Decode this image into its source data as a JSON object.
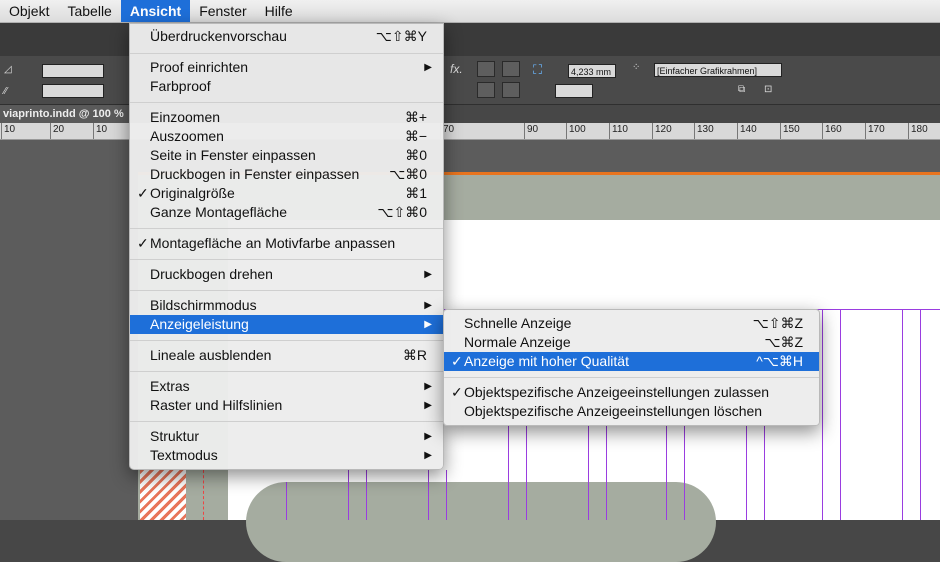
{
  "menubar": {
    "items": [
      "Objekt",
      "Tabelle",
      "Ansicht",
      "Fenster",
      "Hilfe"
    ]
  },
  "document_tab": "viaprinto.indd @ 100 %",
  "ruler_ticks": [
    "10",
    "20",
    "10",
    "70",
    "90",
    "100",
    "110",
    "120",
    "130",
    "140",
    "150",
    "160",
    "170",
    "180"
  ],
  "control": {
    "offset_value": "4,233 mm",
    "frame_style": "[Einfacher Grafikrahmen]",
    "fx_label": "fx."
  },
  "view_menu": {
    "items": [
      {
        "label": "Überdruckenvorschau",
        "shortcut": "⌥⇧⌘Y"
      },
      {
        "label": "Proof einrichten",
        "submenu": true
      },
      {
        "label": "Farbproof"
      },
      {
        "label": "Einzoomen",
        "shortcut": "⌘+"
      },
      {
        "label": "Auszoomen",
        "shortcut": "⌘−"
      },
      {
        "label": "Seite in Fenster einpassen",
        "shortcut": "⌘0"
      },
      {
        "label": "Druckbogen in Fenster einpassen",
        "shortcut": "⌥⌘0"
      },
      {
        "label": "Originalgröße",
        "shortcut": "⌘1",
        "checked": true
      },
      {
        "label": "Ganze Montagefläche",
        "shortcut": "⌥⇧⌘0"
      },
      {
        "label": "Montagefläche an Motivfarbe anpassen",
        "checked": true
      },
      {
        "label": "Druckbogen drehen",
        "submenu": true
      },
      {
        "label": "Bildschirmmodus",
        "submenu": true
      },
      {
        "label": "Anzeigeleistung",
        "submenu": true,
        "highlighted": true
      },
      {
        "label": "Lineale ausblenden",
        "shortcut": "⌘R"
      },
      {
        "label": "Extras",
        "submenu": true
      },
      {
        "label": "Raster und Hilfslinien",
        "submenu": true
      },
      {
        "label": "Struktur",
        "submenu": true
      },
      {
        "label": "Textmodus",
        "submenu": true
      }
    ]
  },
  "display_submenu": {
    "items": [
      {
        "label": "Schnelle Anzeige",
        "shortcut": "⌥⇧⌘Z"
      },
      {
        "label": "Normale Anzeige",
        "shortcut": "⌥⌘Z"
      },
      {
        "label": "Anzeige mit hoher Qualität",
        "shortcut": "^⌥⌘H",
        "checked": true,
        "highlighted": true
      },
      {
        "label": "Objektspezifische Anzeigeeinstellungen zulassen",
        "checked": true
      },
      {
        "label": "Objektspezifische Anzeigeeinstellungen löschen"
      }
    ]
  },
  "glyphs": {
    "check": "✓",
    "arrow": "▶"
  }
}
